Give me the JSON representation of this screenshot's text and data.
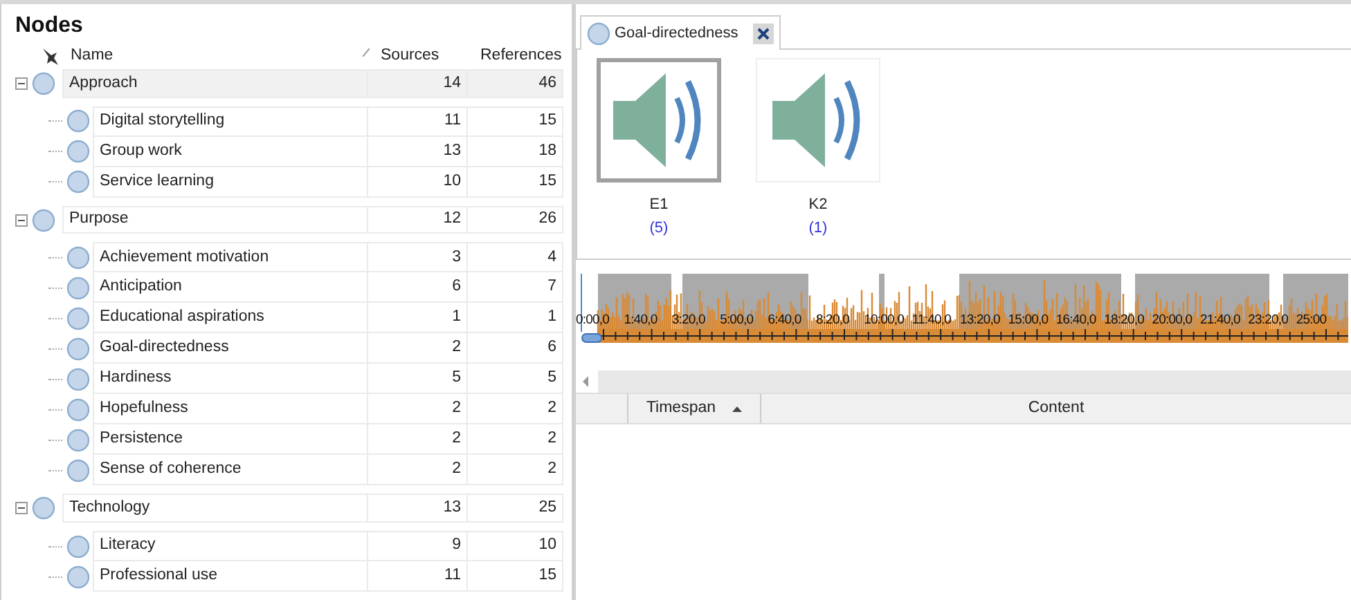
{
  "nodes_panel": {
    "title": "Nodes",
    "columns": [
      "Name",
      "Sources",
      "References"
    ],
    "nodes": [
      {
        "name": "Approach",
        "sources": "14",
        "references": "46",
        "selected": true,
        "expanded": true,
        "children": [
          {
            "name": "Digital storytelling",
            "sources": "11",
            "references": "15",
            "selected": false
          },
          {
            "name": "Group work",
            "sources": "13",
            "references": "18",
            "selected": false
          },
          {
            "name": "Service learning",
            "sources": "10",
            "references": "15",
            "selected": false
          }
        ]
      },
      {
        "name": "Purpose",
        "sources": "12",
        "references": "26",
        "selected": false,
        "expanded": true,
        "children": [
          {
            "name": "Achievement motivation",
            "sources": "3",
            "references": "4",
            "selected": false
          },
          {
            "name": "Anticipation",
            "sources": "6",
            "references": "7",
            "selected": false
          },
          {
            "name": "Educational aspirations",
            "sources": "1",
            "references": "1",
            "selected": false
          },
          {
            "name": "Goal-directedness",
            "sources": "2",
            "references": "6",
            "selected": false
          },
          {
            "name": "Hardiness",
            "sources": "5",
            "references": "5",
            "selected": false
          },
          {
            "name": "Hopefulness",
            "sources": "2",
            "references": "2",
            "selected": false
          },
          {
            "name": "Persistence",
            "sources": "2",
            "references": "2",
            "selected": false
          },
          {
            "name": "Sense of coherence",
            "sources": "2",
            "references": "2",
            "selected": false
          }
        ]
      },
      {
        "name": "Technology",
        "sources": "13",
        "references": "25",
        "selected": false,
        "expanded": true,
        "children": [
          {
            "name": "Literacy",
            "sources": "9",
            "references": "10",
            "selected": false
          },
          {
            "name": "Professional use",
            "sources": "11",
            "references": "15",
            "selected": false
          }
        ]
      }
    ]
  },
  "detail": {
    "tabs": [
      {
        "label": "Goal-directedness",
        "selected": true
      }
    ],
    "media": [
      {
        "label": "E1",
        "count": "(5)",
        "selected": true
      },
      {
        "label": "K2",
        "count": "(1)",
        "selected": false
      }
    ],
    "timeline": {
      "ticks": [
        "0:00,0",
        "1:40,0",
        "3:20,0",
        "5:00,0",
        "6:40,0",
        "8:20,0",
        "10:00,0",
        "11:40,0",
        "13:20,0",
        "15:00,0",
        "16:40,0",
        "18:20,0",
        "20:00,0",
        "21:40,0",
        "23:20,0",
        "25:00"
      ]
    },
    "grid": {
      "columns": [
        "Timespan",
        "Content"
      ]
    }
  }
}
